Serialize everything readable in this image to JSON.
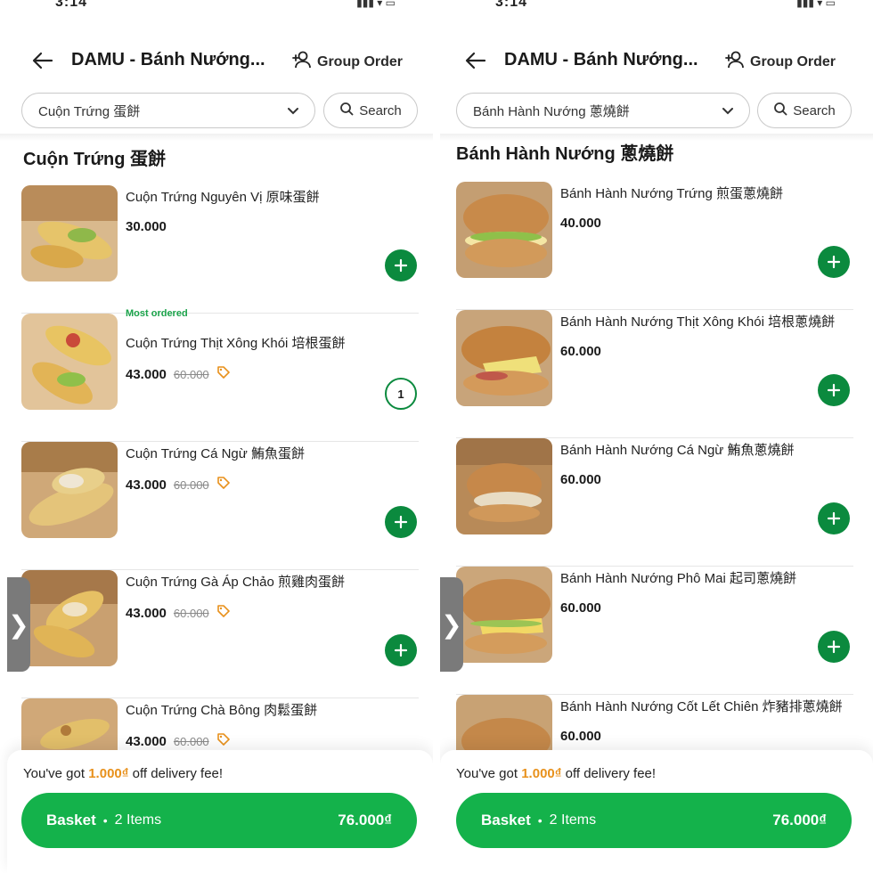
{
  "left": {
    "status": {
      "time": "3:14",
      "icons": "▮▮▮ ▾ ▭"
    },
    "header": {
      "title": "DAMU - Bánh Nướng...",
      "group_order": "Group Order"
    },
    "filter": {
      "category": "Cuộn Trứng 蛋餅",
      "search": "Search"
    },
    "section_title": "Cuộn Trứng 蛋餅",
    "items": [
      {
        "badge": "",
        "name": "Cuộn Trứng Nguyên Vị 原味蛋餅",
        "price": "30.000",
        "old_price": "",
        "qty": ""
      },
      {
        "badge": "Most ordered",
        "name": "Cuộn Trứng Thịt Xông Khói 培根蛋餅",
        "price": "43.000",
        "old_price": "60.000",
        "qty": "1"
      },
      {
        "badge": "",
        "name": "Cuộn Trứng Cá Ngừ 鮪魚蛋餅",
        "price": "43.000",
        "old_price": "60.000",
        "qty": ""
      },
      {
        "badge": "",
        "name": "Cuộn Trứng Gà Áp Chảo 煎雞肉蛋餅",
        "price": "43.000",
        "old_price": "60.000",
        "qty": ""
      },
      {
        "badge": "",
        "name": "Cuộn Trứng Chà Bông 肉鬆蛋餅",
        "price": "43.000",
        "old_price": "60.000",
        "qty": ""
      }
    ],
    "promo": {
      "prefix": "You've got ",
      "amount": "1.000₫",
      "suffix": " off delivery fee!"
    },
    "basket": {
      "label": "Basket",
      "dot": "•",
      "count": "2 Items",
      "total": "76.000₫"
    }
  },
  "right": {
    "status": {
      "time": "3:14",
      "icons": "▮▮▮ ▾ ▭"
    },
    "header": {
      "title": "DAMU - Bánh Nướng...",
      "group_order": "Group Order"
    },
    "filter": {
      "category": "Bánh Hành Nướng 蔥燒餅",
      "search": "Search"
    },
    "section_title": "Bánh Hành Nướng 蔥燒餅",
    "items": [
      {
        "name": "Bánh Hành Nướng Trứng 煎蛋蔥燒餅",
        "price": "40.000"
      },
      {
        "name": "Bánh Hành Nướng Thịt Xông Khói 培根蔥燒餅",
        "price": "60.000"
      },
      {
        "name": "Bánh Hành Nướng Cá Ngừ 鮪魚蔥燒餅",
        "price": "60.000"
      },
      {
        "name": "Bánh Hành Nướng Phô Mai 起司蔥燒餅",
        "price": "60.000"
      },
      {
        "name": "Bánh Hành Nướng Cốt Lết Chiên 炸豬排蔥燒餅",
        "price": "60.000"
      }
    ],
    "promo": {
      "prefix": "You've got ",
      "amount": "1.000₫",
      "suffix": " off delivery fee!"
    },
    "basket": {
      "label": "Basket",
      "dot": "•",
      "count": "2 Items",
      "total": "76.000₫"
    }
  },
  "colors": {
    "brand_green": "#14b24b",
    "dark_green": "#0b8a3e",
    "promo_orange": "#e8911c",
    "badge_green": "#1aa34a"
  },
  "icons": [
    "back-arrow-icon",
    "group-order-icon",
    "chevron-down-icon",
    "search-icon",
    "plus-icon",
    "tag-icon",
    "side-tab-chevron-icon"
  ]
}
